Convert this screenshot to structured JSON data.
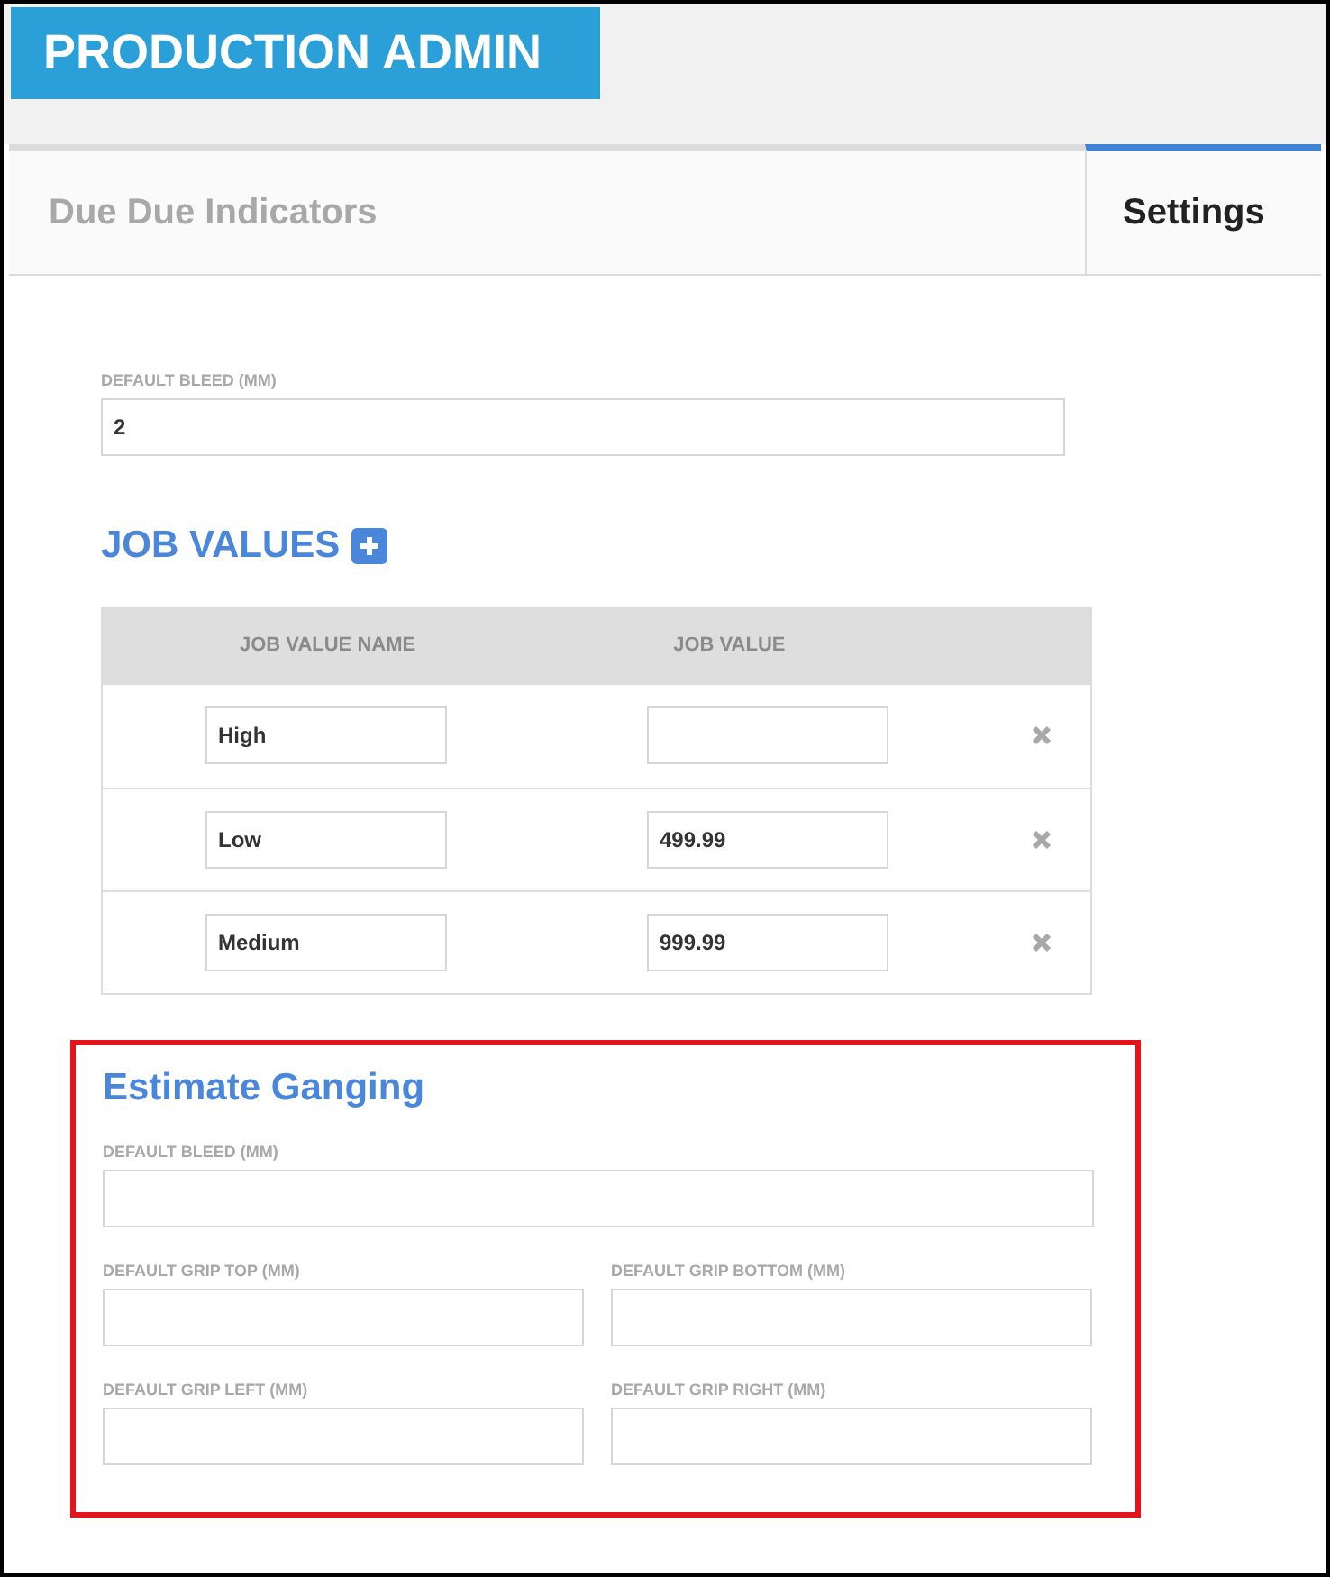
{
  "header": {
    "title": "PRODUCTION ADMIN"
  },
  "tabs": [
    {
      "label": "Due Due Indicators",
      "selected": false
    },
    {
      "label": "Settings",
      "selected": true
    }
  ],
  "default_bleed": {
    "label": "DEFAULT BLEED (MM)",
    "value": "2"
  },
  "job_values": {
    "title": "JOB VALUES",
    "columns": [
      "JOB VALUE NAME",
      "JOB VALUE"
    ],
    "rows": [
      {
        "name": "High"
      },
      {
        "name": "Low",
        "value": "499.99"
      },
      {
        "name": "Medium",
        "value": "999.99"
      }
    ]
  },
  "estimate_ganging": {
    "title": "Estimate Ganging",
    "highlighted": true,
    "fields": [
      {
        "label": "DEFAULT BLEED (MM)",
        "kind": "full"
      },
      {
        "label": "DEFAULT GRIP TOP (MM)",
        "kind": "half"
      },
      {
        "label": "DEFAULT GRIP BOTTOM (MM)",
        "kind": "half"
      },
      {
        "label": "DEFAULT GRIP LEFT (MM)",
        "kind": "half"
      },
      {
        "label": "DEFAULT GRIP RIGHT (MM)",
        "kind": "half"
      }
    ]
  }
}
